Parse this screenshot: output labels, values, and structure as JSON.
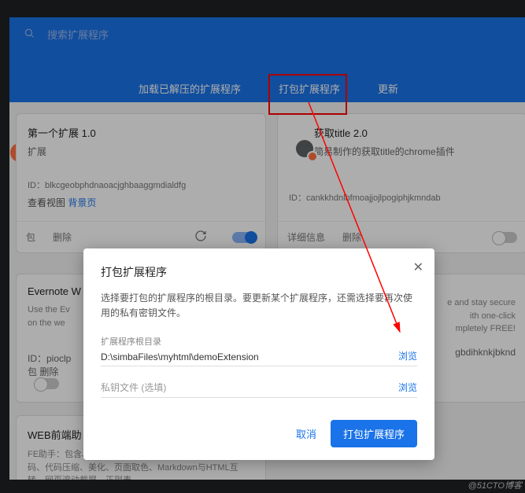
{
  "header": {
    "search_placeholder": "搜索扩展程序",
    "tabs": {
      "load": "加载已解压的扩展程序",
      "pack": "打包扩展程序",
      "update": "更新"
    }
  },
  "cards": {
    "ext1": {
      "title": "第一个扩展  1.0",
      "subtitle": "扩展",
      "id": "ID：blkcgeobphdnaoacjghbaaggmdialdfg",
      "view_label": "查看视图",
      "bg_link": "背景页",
      "detail": "包",
      "remove": "删除"
    },
    "ext2": {
      "title": "获取title  2.0",
      "subtitle": "简易制作的获取title的chrome插件",
      "id": "ID：cankkhdnlbfmoajjojlpogiphjkmndab",
      "detail": "详细信息",
      "remove": "删除"
    },
    "ext3": {
      "title": "Evernote W",
      "desc1": "Use the Ev",
      "desc2": "on the we",
      "id": "ID：pioclp",
      "detail": "包",
      "remove": "删除"
    },
    "ext4": {
      "desc1": "e and stay secure",
      "desc2": "ith one-click",
      "desc3": "mpletely FREE!",
      "id": "gbdihknkjbknd"
    },
    "ext5": {
      "title": "WEB前端助",
      "desc": "FE助手：包含JSON格式化、二维码生成与解码、信息编解码、代码压缩、美化、页面取色、Markdown与HTML互转、网页滚动截屏、正则表"
    }
  },
  "dialog": {
    "title": "打包扩展程序",
    "description": "选择要打包的扩展程序的根目录。要更新某个扩展程序，还需选择要再次使用的私有密钥文件。",
    "root_label": "扩展程序根目录",
    "root_value": "D:\\simbaFiles\\myhtml\\demoExtension",
    "key_label": "私钥文件 (选填)",
    "browse": "浏览",
    "cancel": "取消",
    "pack": "打包扩展程序"
  },
  "watermark": "@51CTO博客"
}
